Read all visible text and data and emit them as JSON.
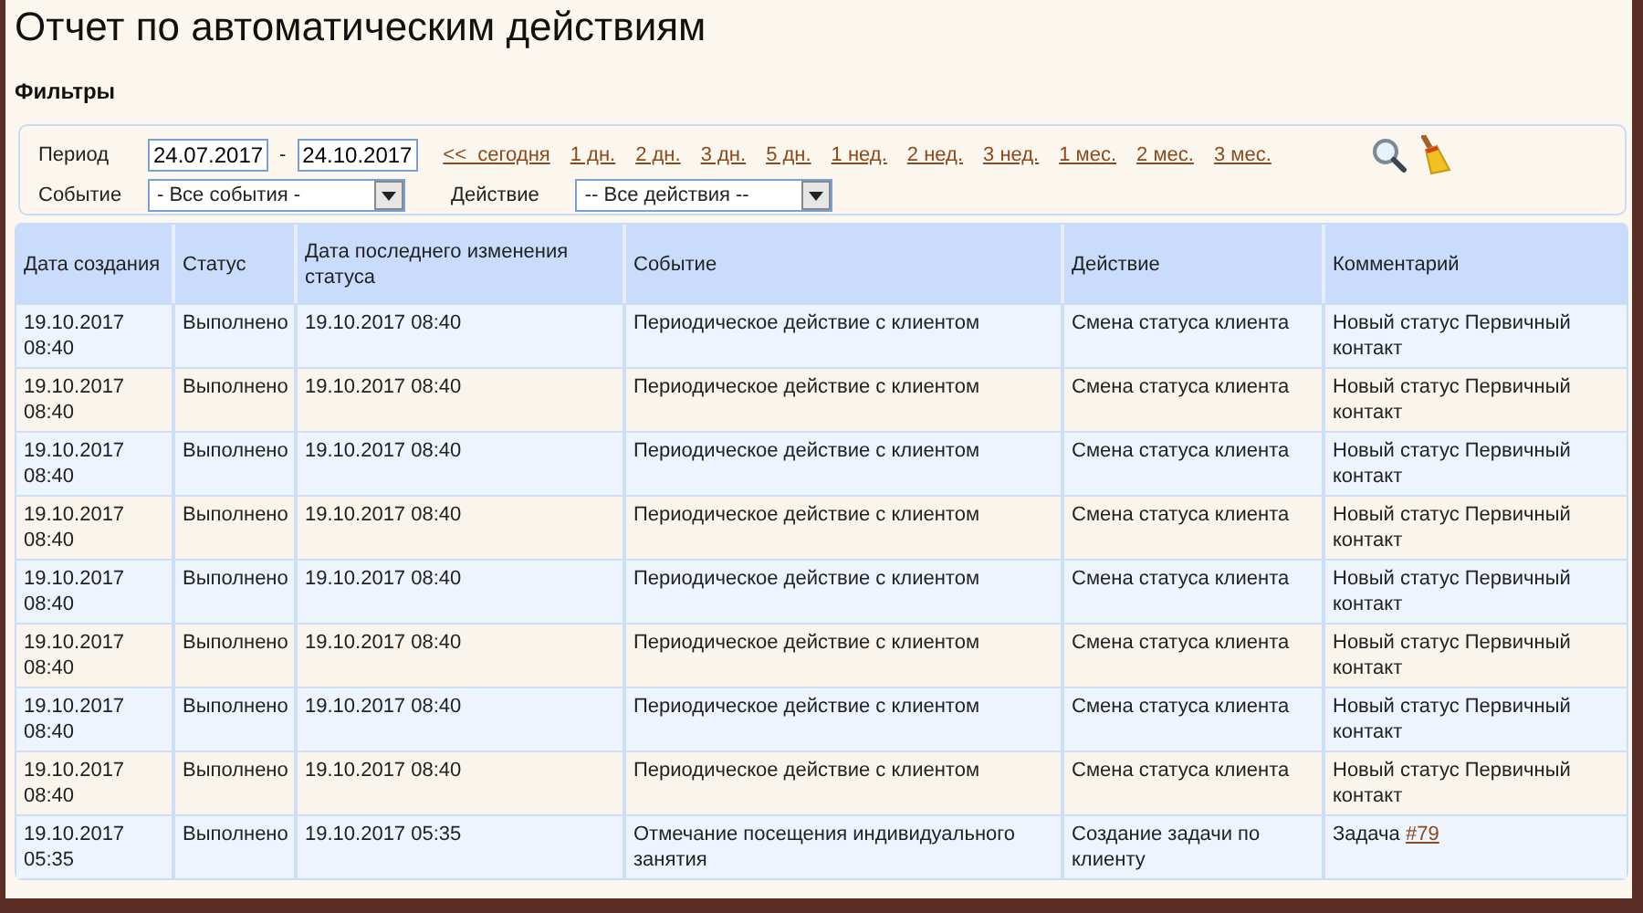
{
  "title": "Отчет по автоматическим действиям",
  "filters": {
    "heading": "Фильтры",
    "period_label": "Период",
    "date_from": "24.07.2017",
    "date_sep": "-",
    "date_to": "24.10.2017",
    "quick_links": [
      "<<  сегодня",
      "1 дн.",
      "2 дн.",
      "3 дн.",
      "5 дн.",
      "1 нед.",
      "2 нед.",
      "3 нед.",
      "1 мес.",
      "2 мес.",
      "3 мес."
    ],
    "event_label": "Событие",
    "event_value": "- Все события -",
    "action_label": "Действие",
    "action_value": "-- Все действия --"
  },
  "table": {
    "columns": [
      "Дата создания",
      "Статус",
      "Дата последнего изменения статуса",
      "Событие",
      "Действие",
      "Комментарий"
    ],
    "rows": [
      {
        "created": "19.10.2017 08:40",
        "status": "Выполнено",
        "changed": "19.10.2017 08:40",
        "event": "Периодическое действие с клиентом",
        "action": "Смена статуса клиента",
        "comment": "Новый статус Первичный контакт"
      },
      {
        "created": "19.10.2017 08:40",
        "status": "Выполнено",
        "changed": "19.10.2017 08:40",
        "event": "Периодическое действие с клиентом",
        "action": "Смена статуса клиента",
        "comment": "Новый статус Первичный контакт"
      },
      {
        "created": "19.10.2017 08:40",
        "status": "Выполнено",
        "changed": "19.10.2017 08:40",
        "event": "Периодическое действие с клиентом",
        "action": "Смена статуса клиента",
        "comment": "Новый статус Первичный контакт"
      },
      {
        "created": "19.10.2017 08:40",
        "status": "Выполнено",
        "changed": "19.10.2017 08:40",
        "event": "Периодическое действие с клиентом",
        "action": "Смена статуса клиента",
        "comment": "Новый статус Первичный контакт"
      },
      {
        "created": "19.10.2017 08:40",
        "status": "Выполнено",
        "changed": "19.10.2017 08:40",
        "event": "Периодическое действие с клиентом",
        "action": "Смена статуса клиента",
        "comment": "Новый статус Первичный контакт"
      },
      {
        "created": "19.10.2017 08:40",
        "status": "Выполнено",
        "changed": "19.10.2017 08:40",
        "event": "Периодическое действие с клиентом",
        "action": "Смена статуса клиента",
        "comment": "Новый статус Первичный контакт"
      },
      {
        "created": "19.10.2017 08:40",
        "status": "Выполнено",
        "changed": "19.10.2017 08:40",
        "event": "Периодическое действие с клиентом",
        "action": "Смена статуса клиента",
        "comment": "Новый статус Первичный контакт"
      },
      {
        "created": "19.10.2017 08:40",
        "status": "Выполнено",
        "changed": "19.10.2017 08:40",
        "event": "Периодическое действие с клиентом",
        "action": "Смена статуса клиента",
        "comment": "Новый статус Первичный контакт"
      },
      {
        "created": "19.10.2017 05:35",
        "status": "Выполнено",
        "changed": "19.10.2017 05:35",
        "event": "Отмечание посещения индивидуального занятия",
        "action": "Создание задачи по клиенту",
        "comment": "Задача",
        "comment_link": "#79"
      }
    ]
  }
}
